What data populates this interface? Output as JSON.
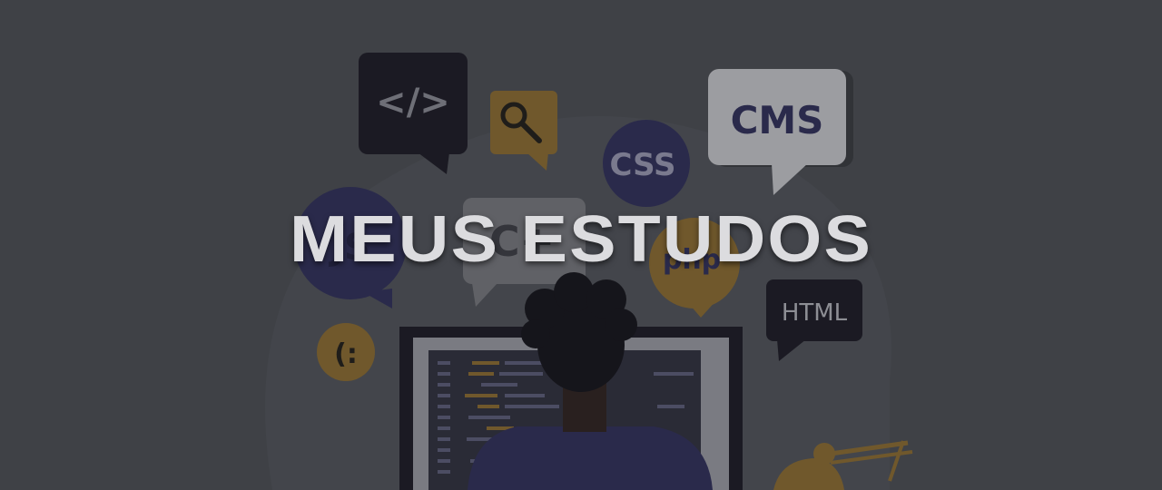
{
  "hero": {
    "title": "MEUS ESTUDOS"
  },
  "bubbles": {
    "code": "</>",
    "css": "CSS",
    "cms": "CMS",
    "html": "HTML",
    "smiley": "(:",
    "js": "JS",
    "cpp": "C+",
    "php": "php"
  },
  "colors": {
    "background": "#484a4f",
    "title": "#dcdcdf",
    "dark_bubble": "#17141f",
    "navy_bubble": "#2c2a57",
    "gold_bubble": "#8c6a2c",
    "light_bubble": "#c9c9ce"
  }
}
